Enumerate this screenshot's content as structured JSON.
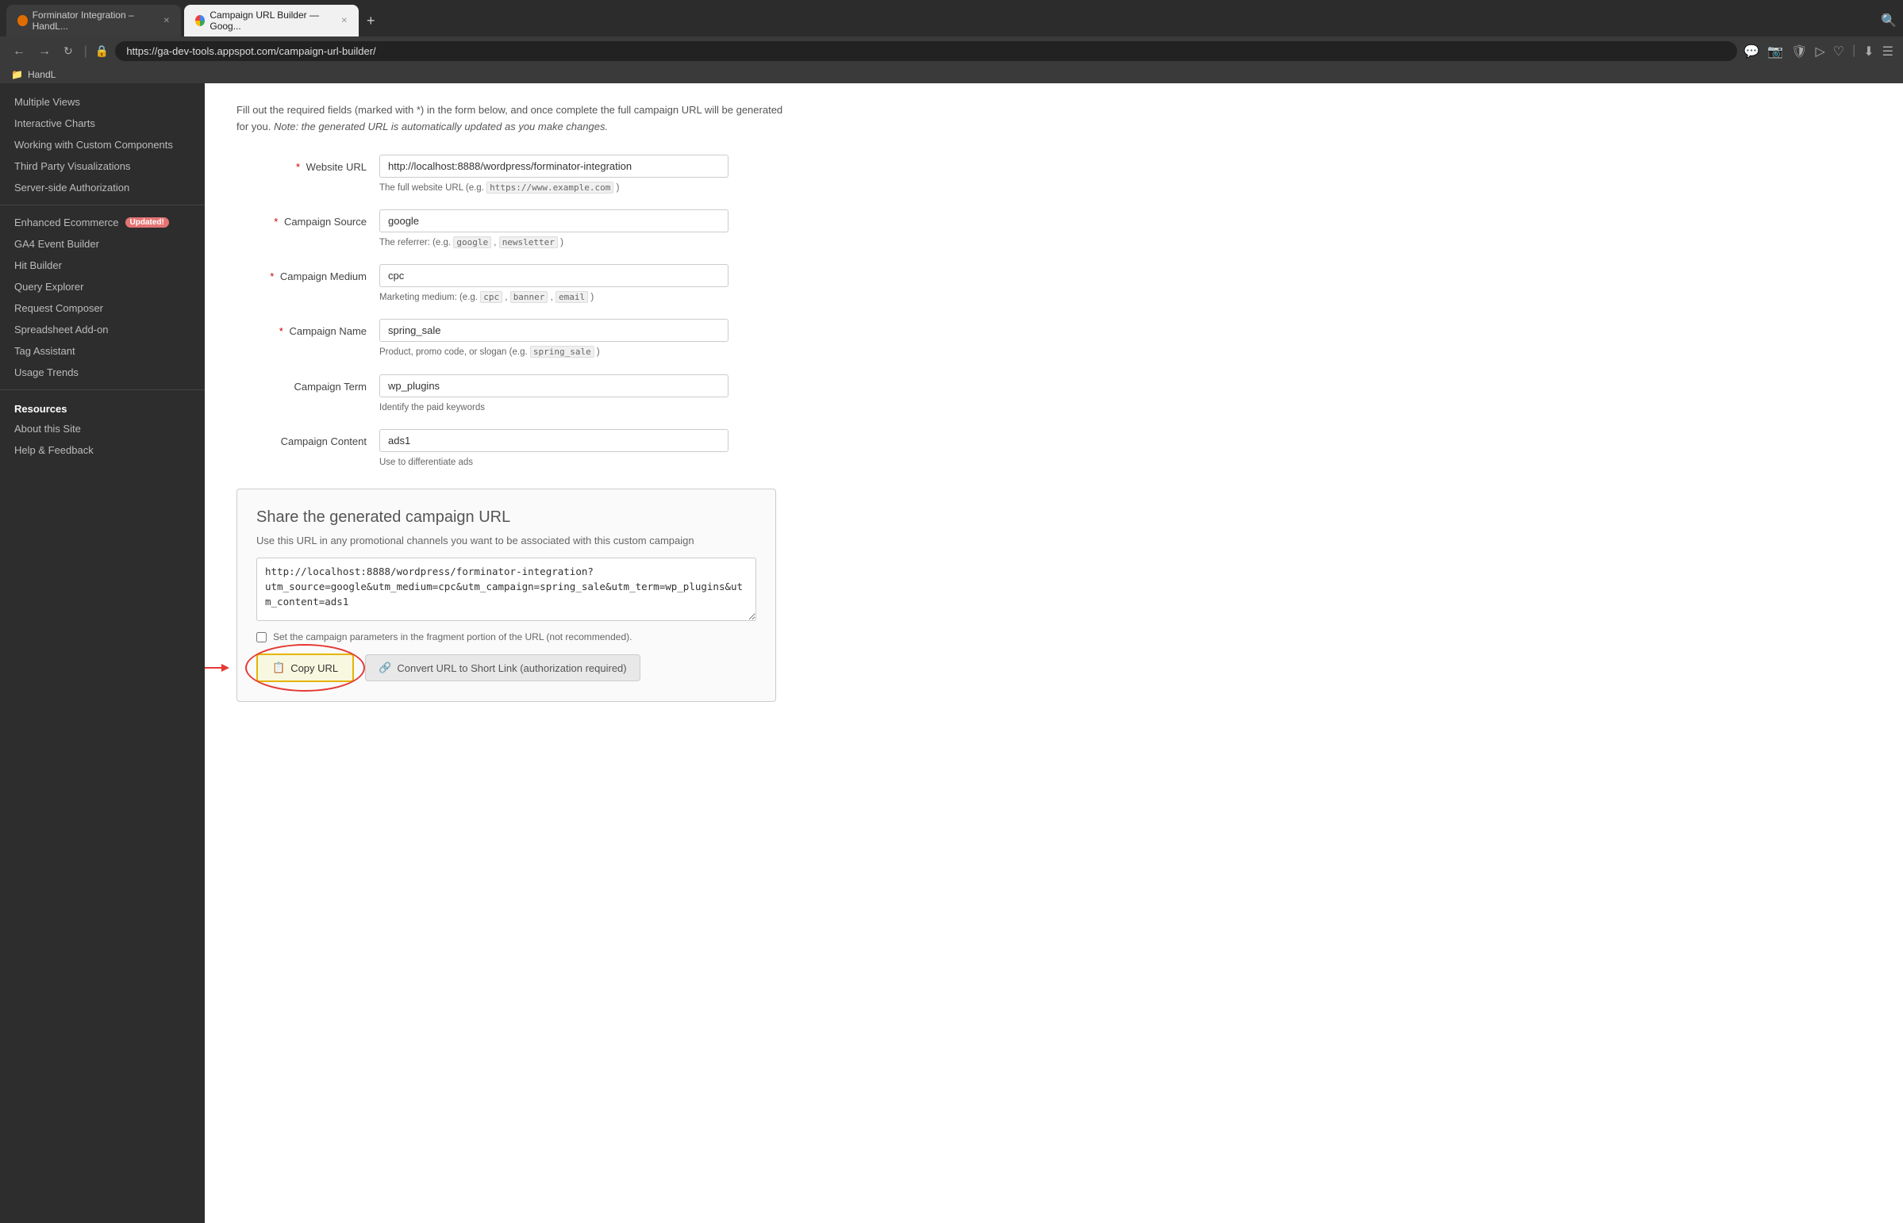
{
  "browser": {
    "tabs": [
      {
        "id": "tab1",
        "label": "Forminator Integration – HandL...",
        "favicon_type": "firefox",
        "active": false
      },
      {
        "id": "tab2",
        "label": "Campaign URL Builder — Goog...",
        "favicon_type": "chrome",
        "active": true
      }
    ],
    "url": "https://ga-dev-tools.appspot.com/campaign-url-builder/",
    "new_tab_label": "+",
    "bookmark_label": "HandL"
  },
  "sidebar": {
    "nav_items": [
      {
        "id": "multiple-views",
        "label": "Multiple Views"
      },
      {
        "id": "interactive-charts",
        "label": "Interactive Charts"
      },
      {
        "id": "custom-components",
        "label": "Working with Custom Components"
      },
      {
        "id": "third-party",
        "label": "Third Party Visualizations"
      },
      {
        "id": "server-auth",
        "label": "Server-side Authorization"
      },
      {
        "id": "enhanced-ecommerce",
        "label": "Enhanced Ecommerce",
        "badge": "Updated!"
      },
      {
        "id": "ga4-event",
        "label": "GA4 Event Builder"
      },
      {
        "id": "hit-builder",
        "label": "Hit Builder"
      },
      {
        "id": "query-explorer",
        "label": "Query Explorer"
      },
      {
        "id": "request-composer",
        "label": "Request Composer"
      },
      {
        "id": "spreadsheet-addon",
        "label": "Spreadsheet Add-on"
      },
      {
        "id": "tag-assistant",
        "label": "Tag Assistant"
      },
      {
        "id": "usage-trends",
        "label": "Usage Trends"
      }
    ],
    "resources_title": "Resources",
    "resources_items": [
      {
        "id": "about-site",
        "label": "About this Site"
      },
      {
        "id": "help-feedback",
        "label": "Help & Feedback"
      }
    ]
  },
  "main": {
    "intro": "Fill out the required fields (marked with *) in the form below, and once complete the full campaign URL will be generated for you.",
    "intro_italic": "Note: the generated URL is automatically updated as you make changes.",
    "fields": [
      {
        "id": "website-url",
        "label": "Website URL",
        "required": true,
        "value": "http://localhost:8888/wordpress/forminator-integration",
        "hint": "The full website URL (e.g.",
        "hint_code": "https://www.example.com",
        "hint_suffix": ")"
      },
      {
        "id": "campaign-source",
        "label": "Campaign Source",
        "required": true,
        "value": "google",
        "hint": "The referrer: (e.g.",
        "hint_code1": "google",
        "hint_sep": ",",
        "hint_code2": "newsletter",
        "hint_suffix": ")"
      },
      {
        "id": "campaign-medium",
        "label": "Campaign Medium",
        "required": true,
        "value": "cpc",
        "hint": "Marketing medium: (e.g.",
        "hint_code1": "cpc",
        "hint_sep": ",",
        "hint_code2": "banner",
        "hint_sep2": ",",
        "hint_code3": "email",
        "hint_suffix": ")"
      },
      {
        "id": "campaign-name",
        "label": "Campaign Name",
        "required": true,
        "value": "spring_sale",
        "hint": "Product, promo code, or slogan (e.g.",
        "hint_code": "spring_sale",
        "hint_suffix": ")"
      },
      {
        "id": "campaign-term",
        "label": "Campaign Term",
        "required": false,
        "value": "wp_plugins",
        "hint": "Identify the paid keywords"
      },
      {
        "id": "campaign-content",
        "label": "Campaign Content",
        "required": false,
        "value": "ads1",
        "hint": "Use to differentiate ads"
      }
    ],
    "share_section": {
      "title": "Share the generated campaign URL",
      "description": "Use this URL in any promotional channels you want to be associated with this custom campaign",
      "generated_url": "http://localhost:8888/wordpress/forminator-integration?utm_source=google&utm_medium=cpc&utm_campaign=spring_sale&utm_term=wp_plugins&utm_content=ads1",
      "fragment_label": "Set the campaign parameters in the fragment portion of the URL (not recommended).",
      "copy_url_label": "Copy URL",
      "convert_label": "Convert URL to Short Link (authorization required)"
    }
  }
}
